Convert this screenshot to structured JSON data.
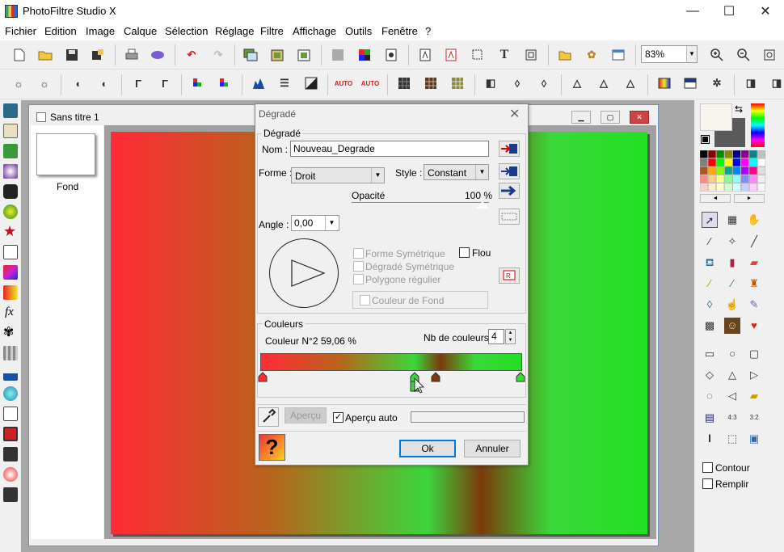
{
  "app": {
    "title": "PhotoFiltre Studio X"
  },
  "menu": [
    "Fichier",
    "Edition",
    "Image",
    "Calque",
    "Sélection",
    "Réglage",
    "Filtre",
    "Affichage",
    "Outils",
    "Fenêtre",
    "?"
  ],
  "toolbar": {
    "zoom_value": "83%"
  },
  "image_window": {
    "title": "Sans titre 1",
    "layer_name": "Fond"
  },
  "dialog": {
    "title": "Dégradé",
    "group_gradient": "Dégradé",
    "name_label": "Nom :",
    "name_value": "Nouveau_Degrade",
    "shape_label": "Forme :",
    "shape_value": "Droit",
    "style_label": "Style :",
    "style_value": "Constant",
    "opacity_label": "Opacité",
    "opacity_value": "100 %",
    "angle_label": "Angle :",
    "angle_value": "0,00",
    "chk_symmetric_shape": "Forme Symétrique",
    "chk_blur": "Flou",
    "chk_symmetric_gradient": "Dégradé Symétrique",
    "chk_regular_polygon": "Polygone régulier",
    "chk_background_color": "Couleur de Fond",
    "group_colors": "Couleurs",
    "color_info": "Couleur N°2 59,06 %",
    "nb_colors_label": "Nb de couleurs :",
    "nb_colors_value": "4",
    "preview_button": "Aperçu",
    "auto_preview": "Aperçu auto",
    "ok_button": "Ok",
    "cancel_button": "Annuler"
  },
  "right_panel": {
    "contour": "Contour",
    "remplir": "Remplir"
  },
  "colors": {
    "stop1": "#ff2a36",
    "stop2": "#3cd63c",
    "stop3": "#7a3a0b",
    "stop4": "#3ad83a"
  }
}
